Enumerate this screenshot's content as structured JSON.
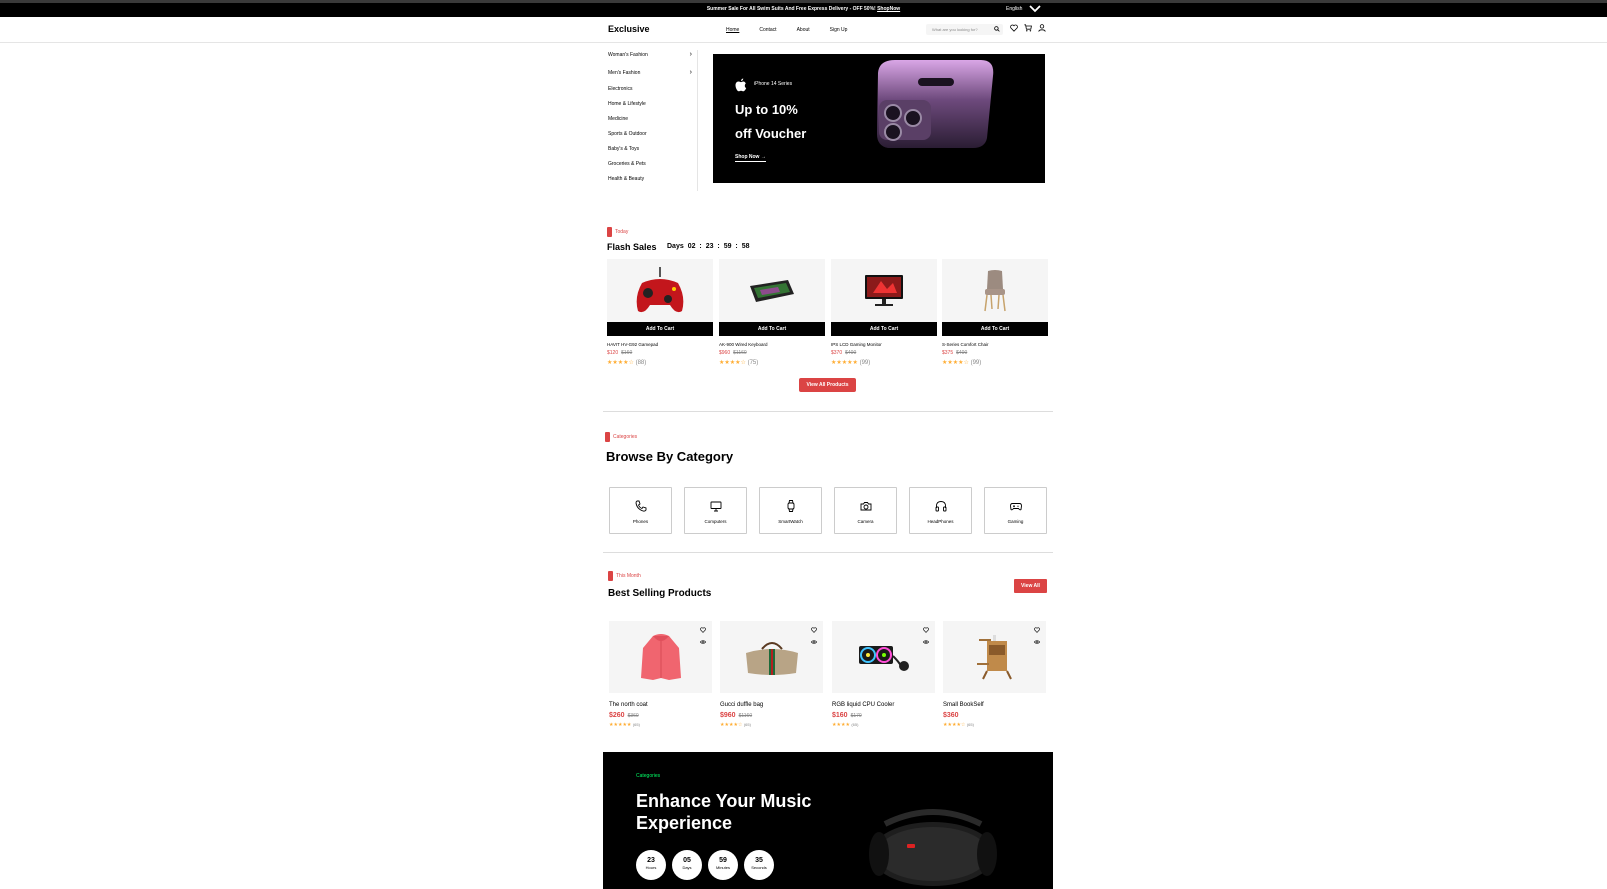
{
  "topbar": {
    "promo": "Summer Sale For All Swim Suits And Free Express Delivery - OFF 50%!",
    "shop_now": "ShopNow",
    "language": "English"
  },
  "header": {
    "logo": "Exclusive",
    "nav": [
      "Home",
      "Contact",
      "About",
      "Sign Up"
    ],
    "search_placeholder": "What are you looking for?"
  },
  "sidebar": {
    "items": [
      "Woman's Fashion",
      "Men's Fashion",
      "Electronics",
      "Home & Lifestyle",
      "Medicine",
      "Sports & Outdoor",
      "Baby's & Toys",
      "Groceries & Pets",
      "Health & Beauty"
    ]
  },
  "hero": {
    "series": "iPhone 14 Series",
    "headline_1": "Up to 10%",
    "headline_2": "off Voucher",
    "cta": "Shop Now →"
  },
  "flash": {
    "tag": "Today",
    "title": "Flash Sales",
    "timer_label": "Days",
    "timer": "02 : 23 : 59 : 58",
    "add_to_cart": "Add To Cart",
    "products": [
      {
        "name": "HAVIT HV-G92 Gamepad",
        "price": "$120",
        "old": "$160",
        "stars": "★★★★☆",
        "count": "(88)"
      },
      {
        "name": "AK-900 Wired Keyboard",
        "price": "$960",
        "old": "$1160",
        "stars": "★★★★☆",
        "count": "(75)"
      },
      {
        "name": "IPS LCD Gaming Monitor",
        "price": "$370",
        "old": "$400",
        "stars": "★★★★★",
        "count": "(99)"
      },
      {
        "name": "S-Series Comfort Chair",
        "price": "$375",
        "old": "$400",
        "stars": "★★★★☆",
        "count": "(99)"
      }
    ],
    "view_all": "View All Products"
  },
  "categories": {
    "tag": "Categories",
    "title": "Browse By Category",
    "items": [
      "Phones",
      "Computers",
      "SmartWatch",
      "Camera",
      "HeadPhones",
      "Gaming"
    ]
  },
  "best": {
    "tag": "This Month",
    "title": "Best Selling Products",
    "view_all": "View All",
    "products": [
      {
        "name": "The north coat",
        "price": "$260",
        "old": "$360",
        "stars": "★★★★★",
        "count": "(65)"
      },
      {
        "name": "Gucci duffle bag",
        "price": "$960",
        "old": "$1160",
        "stars": "★★★★☆",
        "count": "(65)"
      },
      {
        "name": "RGB liquid CPU Cooler",
        "price": "$160",
        "old": "$170",
        "stars": "★★★★",
        "count": "(65)"
      },
      {
        "name": "Small BookSelf",
        "price": "$360",
        "old": "",
        "stars": "★★★★☆",
        "count": "(65)"
      }
    ]
  },
  "music": {
    "tag": "Categories",
    "title_1": "Enhance Your Music",
    "title_2": "Experience",
    "countdown": [
      {
        "n": "23",
        "u": "Hours"
      },
      {
        "n": "05",
        "u": "Days"
      },
      {
        "n": "59",
        "u": "Minutes"
      },
      {
        "n": "35",
        "u": "Seconds"
      }
    ]
  },
  "colors": {
    "accent": "#db4444",
    "star": "#ffad33",
    "music_tag": "#00ff66"
  }
}
